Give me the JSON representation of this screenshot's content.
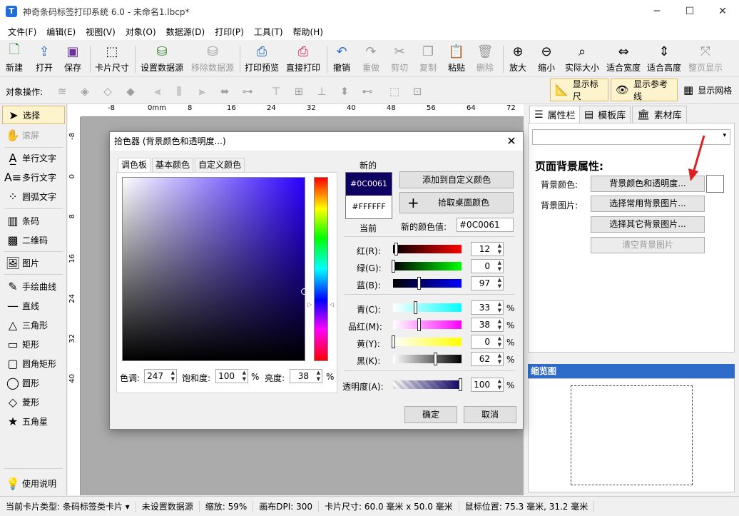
{
  "window": {
    "title": "神奇条码标签打印系统 6.0 - 未命名1.lbcp*",
    "app_icon": "T"
  },
  "menu": [
    "文件(F)",
    "编辑(E)",
    "视图(V)",
    "对象(O)",
    "数据源(D)",
    "打印(P)",
    "工具(T)",
    "帮助(H)"
  ],
  "toolbar": {
    "new": "新建",
    "open": "打开",
    "save": "保存",
    "card_size": "卡片尺寸",
    "set_datasource": "设置数据源",
    "remove_datasource": "移除数据源",
    "print_preview": "打印预览",
    "direct_print": "直接打印",
    "undo": "撤销",
    "redo": "重做",
    "cut": "剪切",
    "copy": "复制",
    "paste": "粘贴",
    "delete": "删除",
    "zoom_in": "放大",
    "zoom_out": "缩小",
    "actual_size": "实际大小",
    "fit_width": "适合宽度",
    "fit_height": "适合高度",
    "full_page": "整页显示"
  },
  "objbar": {
    "label": "对象操作:",
    "show_ruler": "显示标尺",
    "show_guides": "显示参考线",
    "show_grid": "显示网格"
  },
  "tools": [
    "选择",
    "滚屏",
    "单行文字",
    "多行文字",
    "圆弧文字",
    "条码",
    "二维码",
    "图片",
    "手绘曲线",
    "直线",
    "三角形",
    "矩形",
    "圆角矩形",
    "圆形",
    "菱形",
    "五角星",
    "使用说明"
  ],
  "ruler": {
    "top": [
      "-8",
      "0mm",
      "8",
      "16",
      "24",
      "32",
      "40",
      "48",
      "56",
      "64",
      "72"
    ],
    "left": [
      "-8",
      "0",
      "8",
      "16",
      "24",
      "32",
      "40"
    ]
  },
  "right_tabs": [
    "属性栏",
    "模板库",
    "素材库"
  ],
  "props": {
    "heading": "页面背景属性:",
    "bg_color_label": "背景颜色:",
    "bg_color_button": "背景颜色和透明度...",
    "bg_image_label": "背景图片:",
    "common_image_button": "选择常用背景图片...",
    "other_image_button": "选择其它背景图片...",
    "clear_image_button": "清空背景图片"
  },
  "preview": {
    "header": "缩览图"
  },
  "dialog": {
    "title": "拾色器 (背景颜色和透明度...)",
    "tabs": [
      "调色板",
      "基本颜色",
      "自定义颜色"
    ],
    "new_label": "新的",
    "current_label": "当前",
    "new_hex": "#0C0061",
    "current_hex": "#FFFFFF",
    "add_custom": "添加到自定义颜色",
    "pick_desktop": "拾取桌面颜色",
    "new_value_label": "新的颜色值:",
    "new_value": "#0C0061",
    "hue_label": "色调:",
    "hue": "247",
    "sat_label": "饱和度:",
    "sat": "100",
    "bri_label": "亮度:",
    "bri": "38",
    "pct": "%",
    "rgb": [
      {
        "label": "红(R):",
        "value": "12"
      },
      {
        "label": "绿(G):",
        "value": "0"
      },
      {
        "label": "蓝(B):",
        "value": "97"
      }
    ],
    "cmyk": [
      {
        "label": "青(C):",
        "value": "33"
      },
      {
        "label": "品红(M):",
        "value": "38"
      },
      {
        "label": "黄(Y):",
        "value": "0"
      },
      {
        "label": "黑(K):",
        "value": "62"
      }
    ],
    "alpha": {
      "label": "透明度(A):",
      "value": "100"
    },
    "ok": "确定",
    "cancel": "取消"
  },
  "status": {
    "card_type": "当前卡片类型: 条码标签类卡片 ▾",
    "datasource": "未设置数据源",
    "zoom": "缩放: 59%",
    "dpi": "画布DPI: 300",
    "card_size": "卡片尺寸: 60.0 毫米 x 50.0 毫米",
    "mouse": "鼠标位置: 75.3 毫米, 31.2 毫米"
  },
  "colors": {
    "accent": "#2f6bc9",
    "selected_color": "#0C0061",
    "annotation_arrow": "#e02020"
  }
}
